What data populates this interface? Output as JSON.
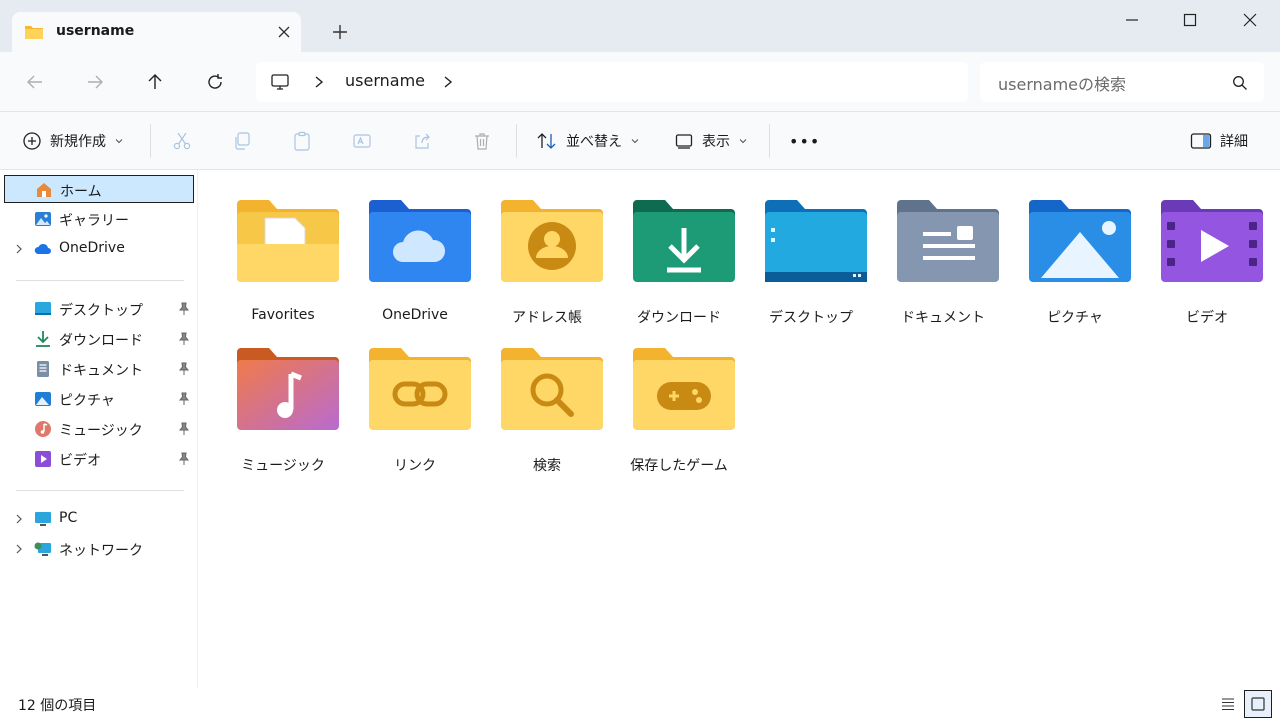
{
  "window": {
    "tab_title": "username",
    "new_tab": "+",
    "minimize": "─",
    "maximize": "☐",
    "close": "✕"
  },
  "address": {
    "crumb": "username",
    "search_placeholder": "usernameの検索"
  },
  "toolbar": {
    "new_label": "新規作成",
    "sort_label": "並べ替え",
    "view_label": "表示",
    "more_label": "•••",
    "details_label": "詳細"
  },
  "sidebar": {
    "items": [
      {
        "label": "ホーム",
        "icon": "home-icon",
        "selected": true
      },
      {
        "label": "ギャラリー",
        "icon": "gallery-icon"
      },
      {
        "label": "OneDrive",
        "icon": "onedrive-icon"
      },
      {
        "label": "デスクトップ",
        "icon": "desktop-icon"
      },
      {
        "label": "ダウンロード",
        "icon": "download-icon"
      },
      {
        "label": "ドキュメント",
        "icon": "documents-icon"
      },
      {
        "label": "ピクチャ",
        "icon": "pictures-icon"
      },
      {
        "label": "ミュージック",
        "icon": "music-icon"
      },
      {
        "label": "ビデオ",
        "icon": "videos-icon"
      },
      {
        "label": "PC",
        "icon": "pc-icon"
      },
      {
        "label": "ネットワーク",
        "icon": "network-icon"
      }
    ]
  },
  "folders": [
    {
      "label": "Favorites",
      "icon": "favorites-folder-icon"
    },
    {
      "label": "OneDrive",
      "icon": "onedrive-folder-icon"
    },
    {
      "label": "アドレス帳",
      "icon": "contacts-folder-icon"
    },
    {
      "label": "ダウンロード",
      "icon": "downloads-folder-icon"
    },
    {
      "label": "デスクトップ",
      "icon": "desktop-folder-icon"
    },
    {
      "label": "ドキュメント",
      "icon": "documents-folder-icon"
    },
    {
      "label": "ピクチャ",
      "icon": "pictures-folder-icon"
    },
    {
      "label": "ビデオ",
      "icon": "videos-folder-icon"
    },
    {
      "label": "ミュージック",
      "icon": "music-folder-icon"
    },
    {
      "label": "リンク",
      "icon": "links-folder-icon"
    },
    {
      "label": "検索",
      "icon": "searches-folder-icon"
    },
    {
      "label": "保存したゲーム",
      "icon": "saved-games-folder-icon"
    }
  ],
  "status": {
    "item_count": "12 個の項目"
  },
  "colors": {
    "folder_yellow": "#f9c52f",
    "folder_yellow_light": "#ffd96a",
    "selection": "#cce8ff",
    "accent": "#1a73e8"
  }
}
